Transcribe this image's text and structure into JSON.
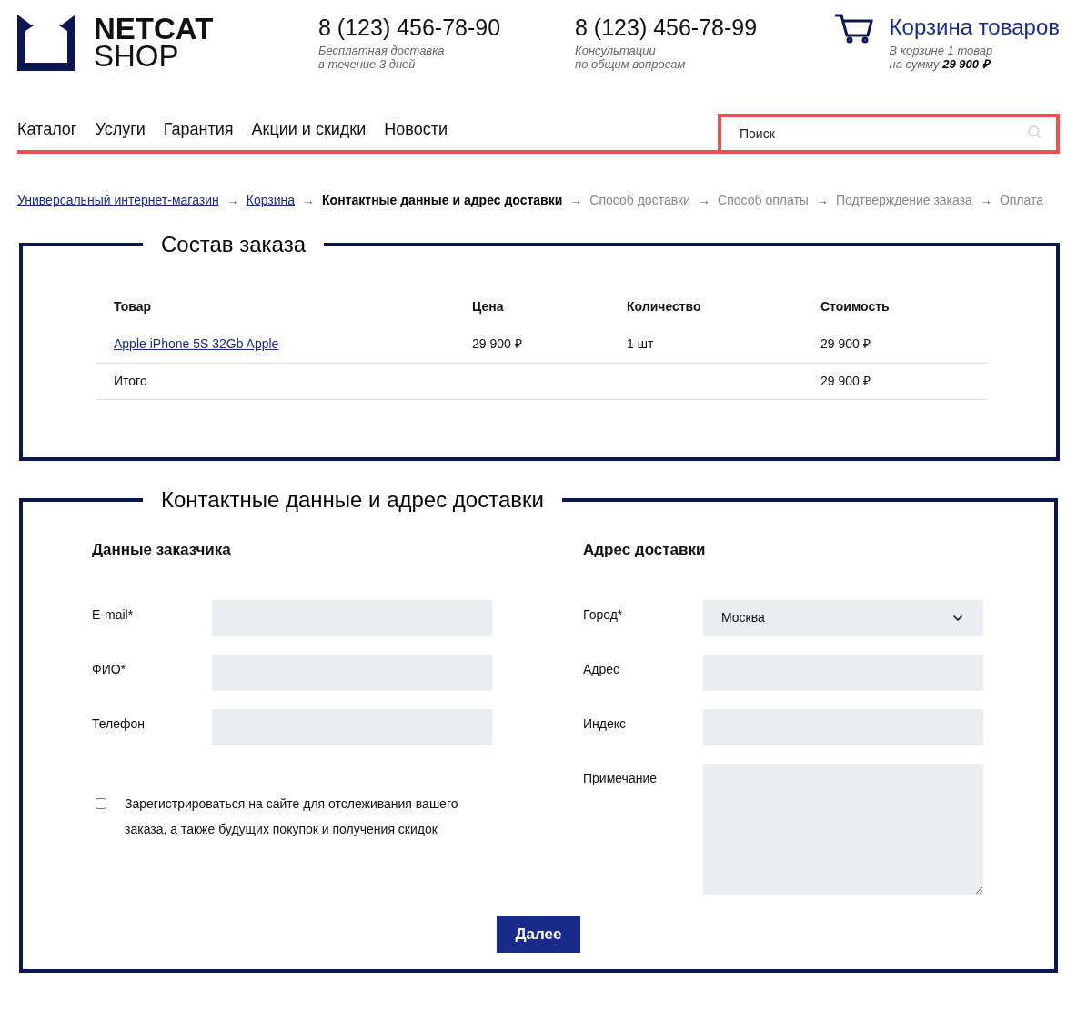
{
  "logo": {
    "line1": "NETCAT",
    "line2": "SHOP"
  },
  "contacts": [
    {
      "phone": "8 (123) 456-78-90",
      "note1": "Бесплатная доставка",
      "note2": "в течение 3 дней"
    },
    {
      "phone": "8 (123) 456-78-99",
      "note1": "Консультации",
      "note2": "по общим вопросам"
    }
  ],
  "cart": {
    "title": "Корзина товаров",
    "line1": "В корзине 1 товар",
    "line2": "на сумму **29 900 ₽**"
  },
  "nav": [
    "Каталог",
    "Услуги",
    "Гарантия",
    "Акции и скидки",
    "Новости"
  ],
  "search": {
    "placeholder": "Поиск"
  },
  "breadcrumbs": [
    {
      "label": "Универсальный интернет-магазин",
      "kind": "link"
    },
    {
      "arrow": "→",
      "label": "Корзина",
      "kind": "link"
    },
    {
      "arrow": "→",
      "label": "Контактные данные и адрес доставки",
      "kind": "current"
    },
    {
      "arrow": "→",
      "label": "Способ доставки",
      "kind": "pending"
    },
    {
      "arrow": "→",
      "label": "Способ оплаты",
      "kind": "pending"
    },
    {
      "arrow": "→",
      "label": "Подтверждение заказа",
      "kind": "pending"
    },
    {
      "arrow": "→",
      "label": "Оплата",
      "kind": "pending"
    }
  ],
  "order": {
    "title": "Состав заказа",
    "columns": [
      "Товар",
      "Цена",
      "Количество",
      "Стоимость"
    ],
    "rows": [
      {
        "product": "Apple iPhone 5S 32Gb Apple",
        "price": "29 900 ₽",
        "quantity": "1 шт",
        "cost": "29 900 ₽"
      }
    ],
    "total": {
      "label": "Итого",
      "cost": "29 900 ₽"
    }
  },
  "contact_form": {
    "title": "Контактные данные и адрес доставки",
    "customer": {
      "heading": "Данные заказчика",
      "fields": [
        {
          "label": "E-mail*"
        },
        {
          "label": "ФИО*"
        },
        {
          "label": "Телефон"
        }
      ],
      "register": {
        "label": "Зарегистрироваться на сайте для отслеживания вашего заказа, а также будущих покупок и получения скидок",
        "checked": false
      }
    },
    "delivery": {
      "heading": "Адрес доставки",
      "fields": [
        {
          "label": "Город*",
          "kind": "select",
          "value": "Москва"
        },
        {
          "label": "Адрес",
          "kind": "text"
        },
        {
          "label": "Индекс",
          "kind": "text"
        },
        {
          "label": "Примечание",
          "kind": "textarea"
        }
      ]
    },
    "submit": "Далее"
  }
}
